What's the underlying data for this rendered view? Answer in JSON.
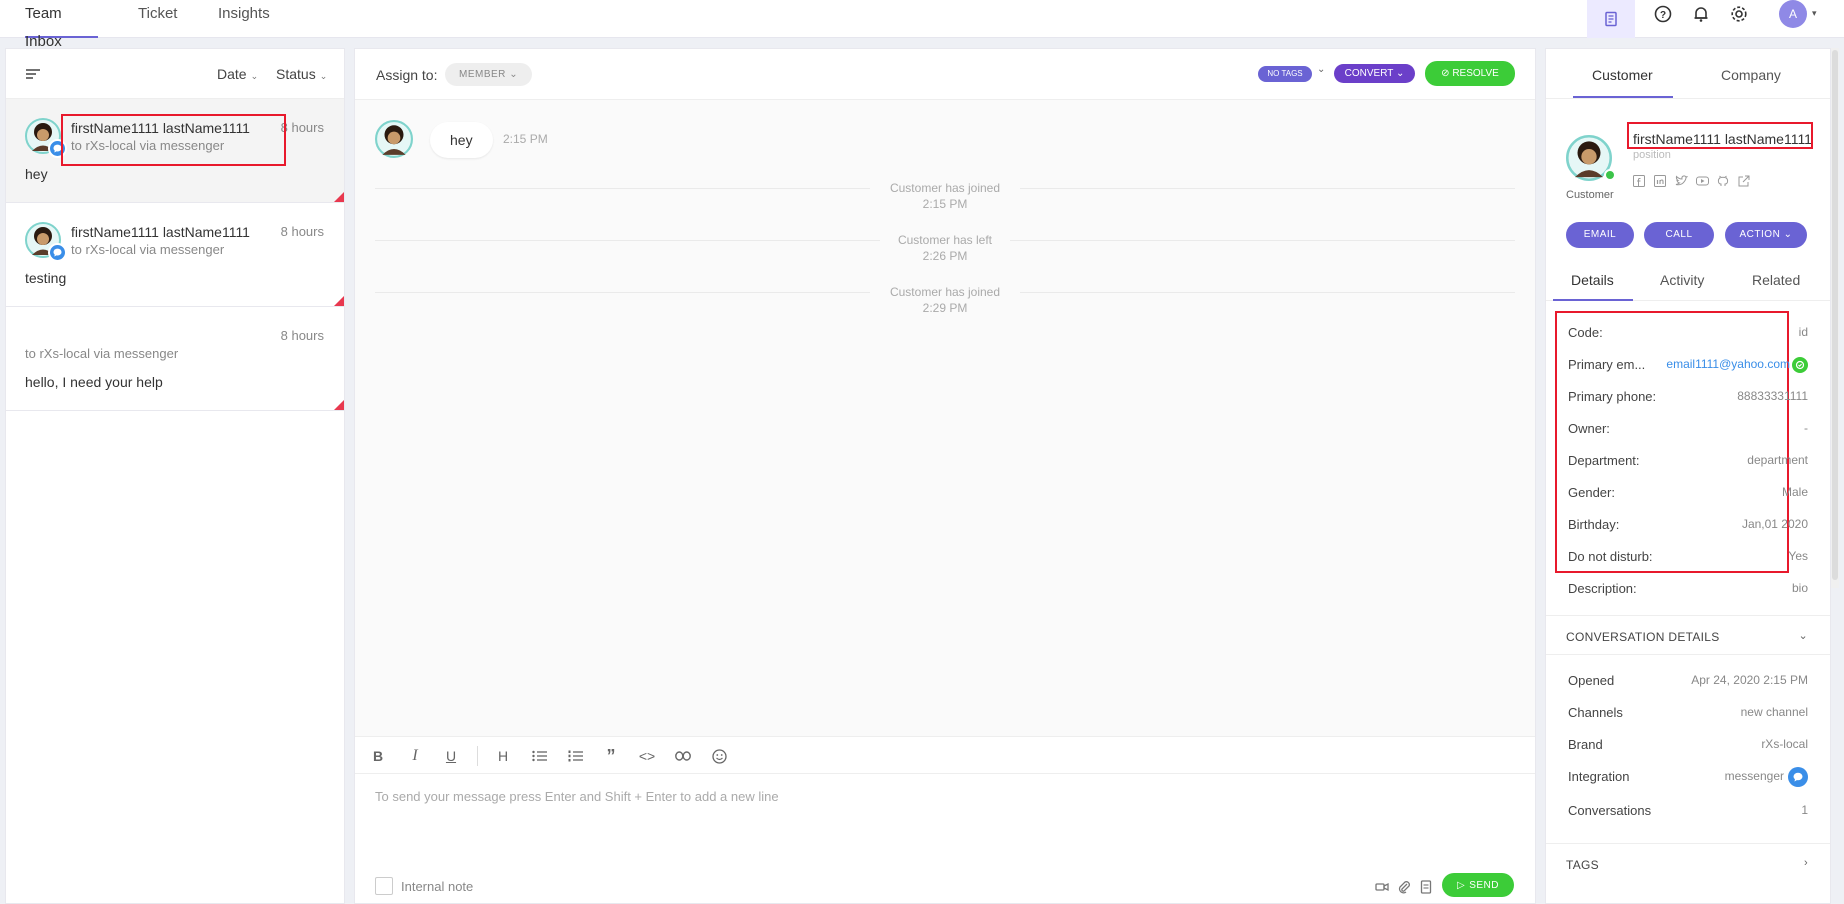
{
  "topnav": {
    "tabs": [
      {
        "label": "Team Inbox",
        "active": true
      },
      {
        "label": "Ticket"
      },
      {
        "label": "Insights"
      }
    ],
    "user_initial": "A"
  },
  "left": {
    "sort_date": "Date",
    "sort_status": "Status",
    "conversations": [
      {
        "name": "firstName1111 lastName1111",
        "sub": "to rXs-local via messenger",
        "time": "8 hours",
        "message": "hey"
      },
      {
        "name": "firstName1111 lastName1111",
        "sub": "to rXs-local via messenger",
        "time": "8 hours",
        "message": "testing"
      },
      {
        "name": "",
        "sub": "to rXs-local via messenger",
        "time": "8 hours",
        "message": "hello, I need your help"
      }
    ]
  },
  "center": {
    "assign_label": "Assign to:",
    "member_pill": "MEMBER",
    "tags_pill": "NO TAGS",
    "convert_pill": "CONVERT",
    "resolve_pill": "RESOLVE",
    "message": {
      "text": "hey",
      "time": "2:15 PM"
    },
    "system_messages": [
      {
        "text": "Customer has joined",
        "time": "2:15 PM"
      },
      {
        "text": "Customer has left",
        "time": "2:26 PM"
      },
      {
        "text": "Customer has joined",
        "time": "2:29 PM"
      }
    ],
    "editor_placeholder": "To send your message press Enter and Shift + Enter to add a new line",
    "internal_note": "Internal note",
    "send_label": "SEND"
  },
  "right": {
    "tabs": [
      "Customer",
      "Company"
    ],
    "customer_name": "firstName1111 lastName1111",
    "customer_position": "position",
    "customer_label": "Customer",
    "buttons": {
      "email": "EMAIL",
      "call": "CALL",
      "action": "ACTION"
    },
    "sub_tabs": [
      "Details",
      "Activity",
      "Related"
    ],
    "details": [
      {
        "label": "Code:",
        "value": "id"
      },
      {
        "label": "Primary em...",
        "value": "email1111@yahoo.com"
      },
      {
        "label": "Primary phone:",
        "value": "88833331111"
      },
      {
        "label": "Owner:",
        "value": "-"
      },
      {
        "label": "Department:",
        "value": "department"
      },
      {
        "label": "Gender:",
        "value": "Male"
      },
      {
        "label": "Birthday:",
        "value": "Jan,01 2020"
      },
      {
        "label": "Do not disturb:",
        "value": "Yes"
      },
      {
        "label": "Description:",
        "value": "bio"
      }
    ],
    "conversation_details_title": "CONVERSATION DETAILS",
    "conversation_details": [
      {
        "label": "Opened",
        "value": "Apr 24, 2020 2:15 PM"
      },
      {
        "label": "Channels",
        "value": "new channel"
      },
      {
        "label": "Brand",
        "value": "rXs-local"
      },
      {
        "label": "Integration",
        "value": "messenger"
      },
      {
        "label": "Conversations",
        "value": "1"
      }
    ],
    "tags_title": "TAGS"
  },
  "colors": {
    "accent": "#6a63d4",
    "success": "#3ccc38",
    "highlight": "#e8192c",
    "link": "#3a8ee8"
  }
}
